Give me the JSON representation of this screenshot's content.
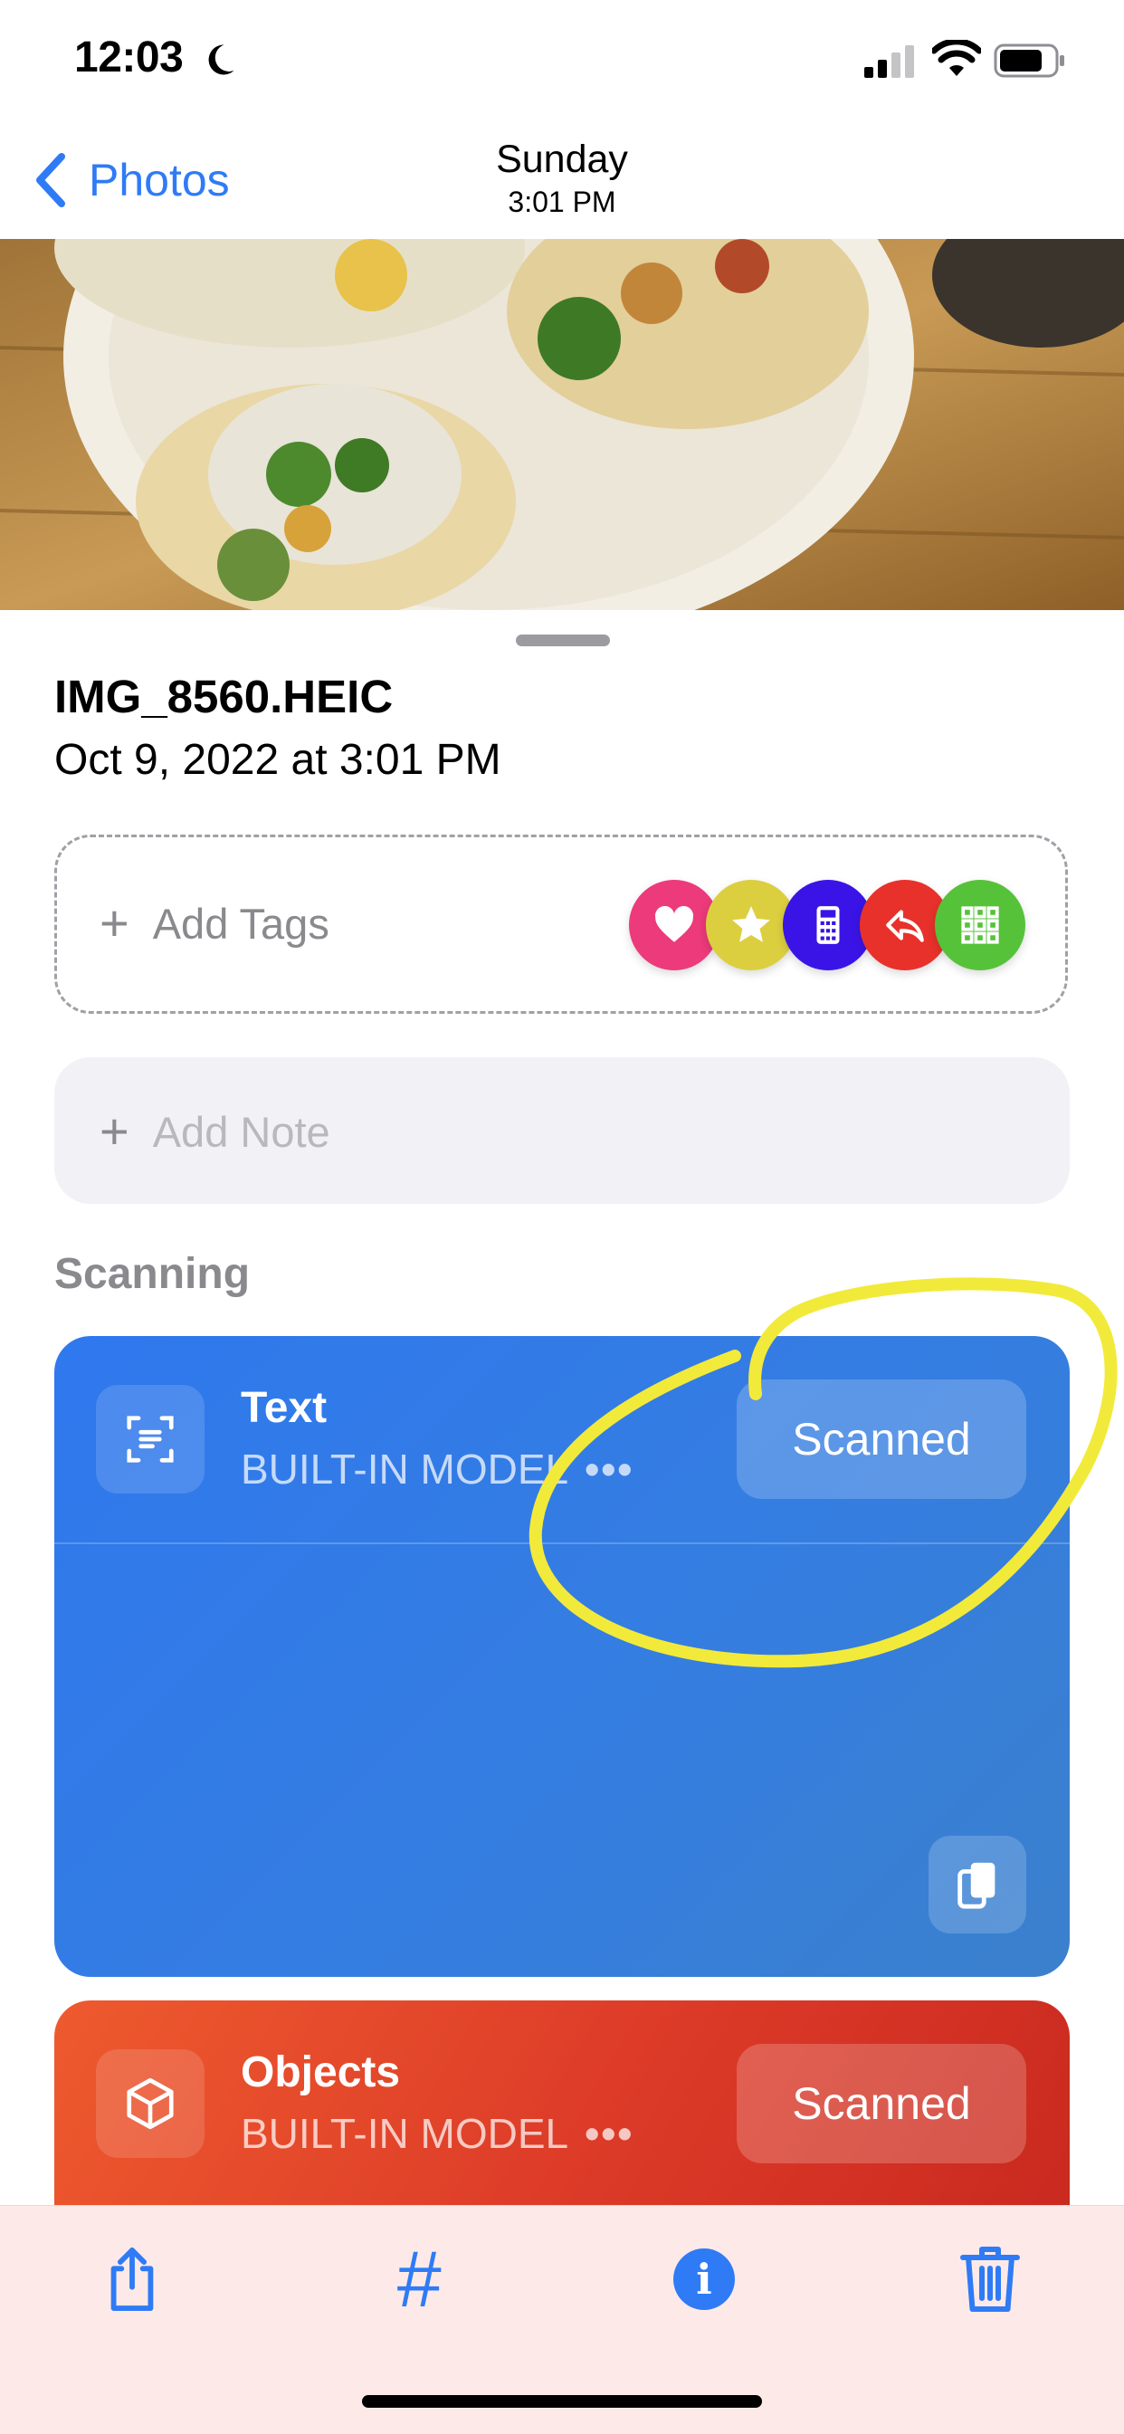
{
  "status_bar": {
    "time": "12:03"
  },
  "nav": {
    "back_label": "Photos",
    "title": "Sunday",
    "subtitle": "3:01 PM"
  },
  "file": {
    "name": "IMG_8560.HEIC",
    "date": "Oct 9, 2022 at 3:01 PM"
  },
  "tags": {
    "add_label": "Add Tags",
    "quick_tags": [
      {
        "icon": "heart-icon",
        "color": "#ec3a7a"
      },
      {
        "icon": "star-icon",
        "color": "#dccf3f"
      },
      {
        "icon": "calculator-icon",
        "color": "#3a14e6"
      },
      {
        "icon": "reply-icon",
        "color": "#e8312b"
      },
      {
        "icon": "grid-icon",
        "color": "#56c23a"
      }
    ]
  },
  "note": {
    "add_label": "Add Note"
  },
  "scanning": {
    "heading": "Scanning",
    "text_card": {
      "title": "Text",
      "model": "BUILT-IN MODEL",
      "more": "•••",
      "status": "Scanned",
      "color": "#3079ee"
    },
    "objects_card": {
      "title": "Objects",
      "model": "BUILT-IN MODEL",
      "more": "•••",
      "status": "Scanned",
      "color": "#e04a2a"
    }
  },
  "annotation": {
    "color": "#f2ea3a"
  },
  "tab_bar": {
    "items": [
      {
        "icon": "share-icon"
      },
      {
        "icon": "hashtag-icon",
        "glyph": "#"
      },
      {
        "icon": "info-icon",
        "glyph": "i"
      },
      {
        "icon": "trash-icon"
      }
    ],
    "color": "#2f7bf6"
  }
}
